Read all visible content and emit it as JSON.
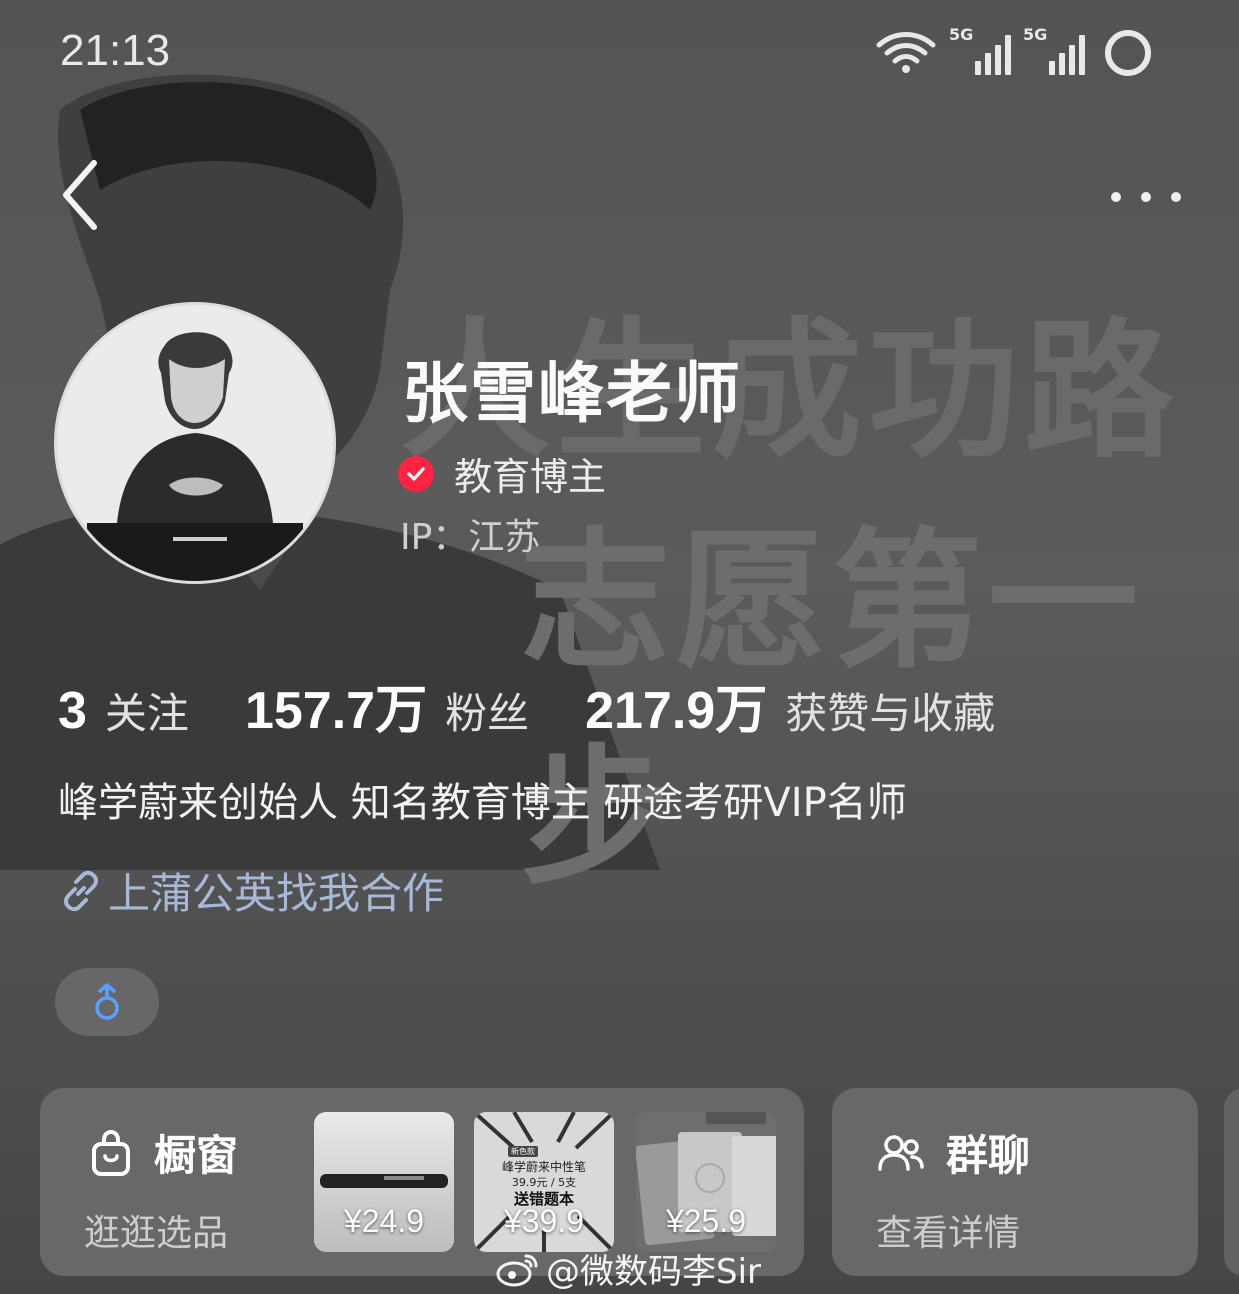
{
  "status_bar": {
    "time": "21:13",
    "network_1": "5G",
    "network_2": "5G",
    "icons": [
      "wifi-icon",
      "signal-icon",
      "signal-icon",
      "battery-icon"
    ]
  },
  "nav": {
    "icons": [
      "back-icon",
      "more-icon"
    ]
  },
  "background": {
    "line1": "人生成功路",
    "line2": "志愿第一步"
  },
  "profile": {
    "name": "张雪峰老师",
    "verified_label": "教育博主",
    "ip": "IP：江苏",
    "bio": "峰学蔚来创始人 知名教育博主 研途考研VIP名师",
    "collab_link": "上蒲公英找我合作",
    "accent_color": "#ff2442",
    "link_color": "#a7b9d6"
  },
  "stats": [
    {
      "value": "3",
      "label": "关注"
    },
    {
      "value": "157.7万",
      "label": "粉丝"
    },
    {
      "value": "217.9万",
      "label": "获赞与收藏"
    }
  ],
  "gender": {
    "icon": "male-icon",
    "color": "#5aa0ff"
  },
  "shop_card": {
    "title": "橱窗",
    "subtitle": "逛逛选品",
    "icon": "shopping-bag-icon",
    "products": [
      {
        "price": "¥24.9"
      },
      {
        "price": "¥39.9",
        "line1": "峰学蔚来中性笔",
        "line2": "39.9元 / 5支",
        "line3": "送错题本",
        "tag": "新色款"
      },
      {
        "price": "¥25.9"
      }
    ]
  },
  "group_card": {
    "title": "群聊",
    "subtitle": "查看详情",
    "icon": "group-icon"
  },
  "watermark": "@微数码李Sir"
}
